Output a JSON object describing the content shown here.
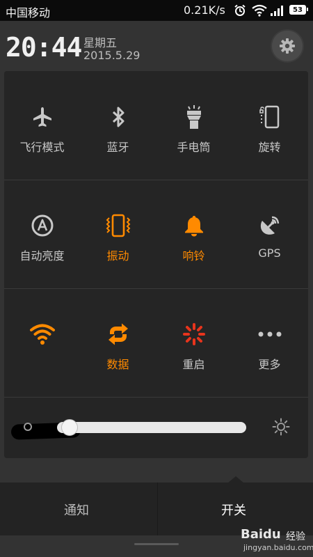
{
  "status_bar": {
    "carrier": "中国移动",
    "net_speed": "0.21K/s",
    "battery": "53",
    "icons": [
      "alarm-icon",
      "wifi-icon",
      "signal-icon",
      "battery-icon"
    ]
  },
  "header": {
    "time": "20:44",
    "weekday": "星期五",
    "date": "2015.5.29",
    "settings_icon": "gear-icon"
  },
  "toggles": [
    {
      "label": "飞行模式",
      "icon": "airplane-icon",
      "active": false
    },
    {
      "label": "蓝牙",
      "icon": "bluetooth-icon",
      "active": false
    },
    {
      "label": "手电筒",
      "icon": "flashlight-icon",
      "active": false
    },
    {
      "label": "旋转",
      "icon": "rotate-icon",
      "active": false
    },
    {
      "label": "自动亮度",
      "icon": "auto-brightness-icon",
      "active": false
    },
    {
      "label": "振动",
      "icon": "vibrate-icon",
      "active": true
    },
    {
      "label": "响铃",
      "icon": "bell-icon",
      "active": true
    },
    {
      "label": "GPS",
      "icon": "gps-icon",
      "active": false
    },
    {
      "label": "",
      "icon": "wifi-icon",
      "active": true
    },
    {
      "label": "数据",
      "icon": "data-icon",
      "active": true
    },
    {
      "label": "重启",
      "icon": "reboot-icon",
      "active": false
    },
    {
      "label": "更多",
      "icon": "more-icon",
      "active": false
    }
  ],
  "brightness": {
    "level": 0.04,
    "low_icon": "brightness-low-icon",
    "high_icon": "brightness-high-icon"
  },
  "tabs": {
    "notify": "通知",
    "switch": "开关",
    "active": "开关"
  },
  "watermark": {
    "logo": "Baidu",
    "tag": "经验",
    "url": "jingyan.baidu.com"
  },
  "colors": {
    "accent": "#ff8a00",
    "reboot": "#e8341c",
    "inactive": "#c8c8c8"
  }
}
